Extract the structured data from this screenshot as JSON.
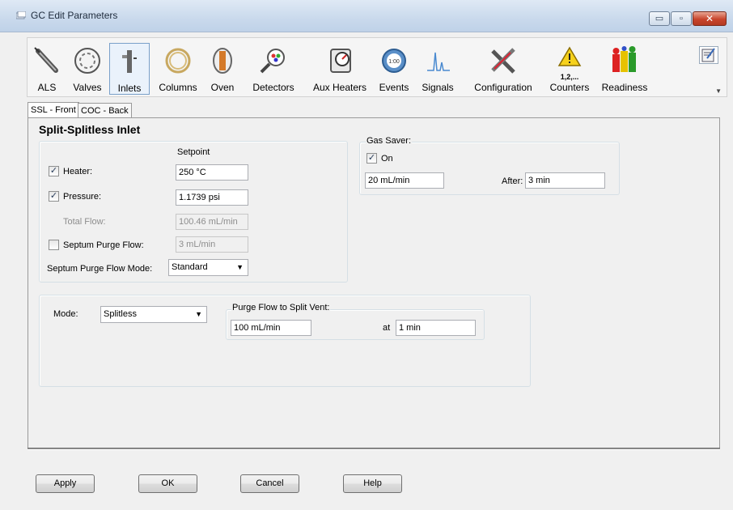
{
  "window": {
    "title": "GC Edit Parameters",
    "min_glyph": "▭",
    "max_glyph": "▫",
    "close_glyph": "✕"
  },
  "toolbar": {
    "items": [
      {
        "label": "ALS",
        "icon": "als-syringe-icon"
      },
      {
        "label": "Valves",
        "icon": "valves-icon"
      },
      {
        "label": "Inlets",
        "icon": "inlets-icon"
      },
      {
        "label": "Columns",
        "icon": "columns-icon"
      },
      {
        "label": "Oven",
        "icon": "oven-icon"
      },
      {
        "label": "Detectors",
        "icon": "detectors-icon"
      },
      {
        "label": "Aux Heaters",
        "icon": "aux-heaters-icon"
      },
      {
        "label": "Events",
        "icon": "events-icon"
      },
      {
        "label": "Signals",
        "icon": "signals-icon"
      },
      {
        "label": "Configuration",
        "icon": "configuration-icon"
      },
      {
        "label": "Counters",
        "icon": "counters-icon"
      },
      {
        "label": "Readiness",
        "icon": "readiness-icon"
      }
    ],
    "counters_icon_text": "1,2,..."
  },
  "tabs": [
    {
      "label": "SSL - Front"
    },
    {
      "label": "COC - Back"
    }
  ],
  "inlet": {
    "title": "Split-Splitless Inlet",
    "setpoint_header": "Setpoint",
    "heater": {
      "label": "Heater:",
      "value": "250 °C",
      "checked": "✓"
    },
    "pressure": {
      "label": "Pressure:",
      "value": "1.1739 psi",
      "checked": "✓"
    },
    "total_flow": {
      "label": "Total Flow:",
      "value": "100.46 mL/min"
    },
    "septum_purge_flow": {
      "label": "Septum Purge Flow:",
      "value": "3 mL/min"
    },
    "septum_purge_mode": {
      "label": "Septum Purge Flow Mode:",
      "value": "Standard"
    }
  },
  "gas_saver": {
    "title": "Gas Saver:",
    "on_label": "On",
    "on_checked": "✓",
    "flow": "20 mL/min",
    "after_label": "After:",
    "after_value": "3 min"
  },
  "mode": {
    "label": "Mode:",
    "value": "Splitless",
    "purge_title": "Purge Flow to Split Vent:",
    "purge_flow": "100 mL/min",
    "at_label": "at",
    "at_value": "1 min"
  },
  "buttons": {
    "apply": "Apply",
    "ok": "OK",
    "cancel": "Cancel",
    "help": "Help"
  },
  "colors": {
    "accent": "#7aa0c9",
    "titlebar": "#c9d9ec",
    "close": "#c8452c"
  }
}
